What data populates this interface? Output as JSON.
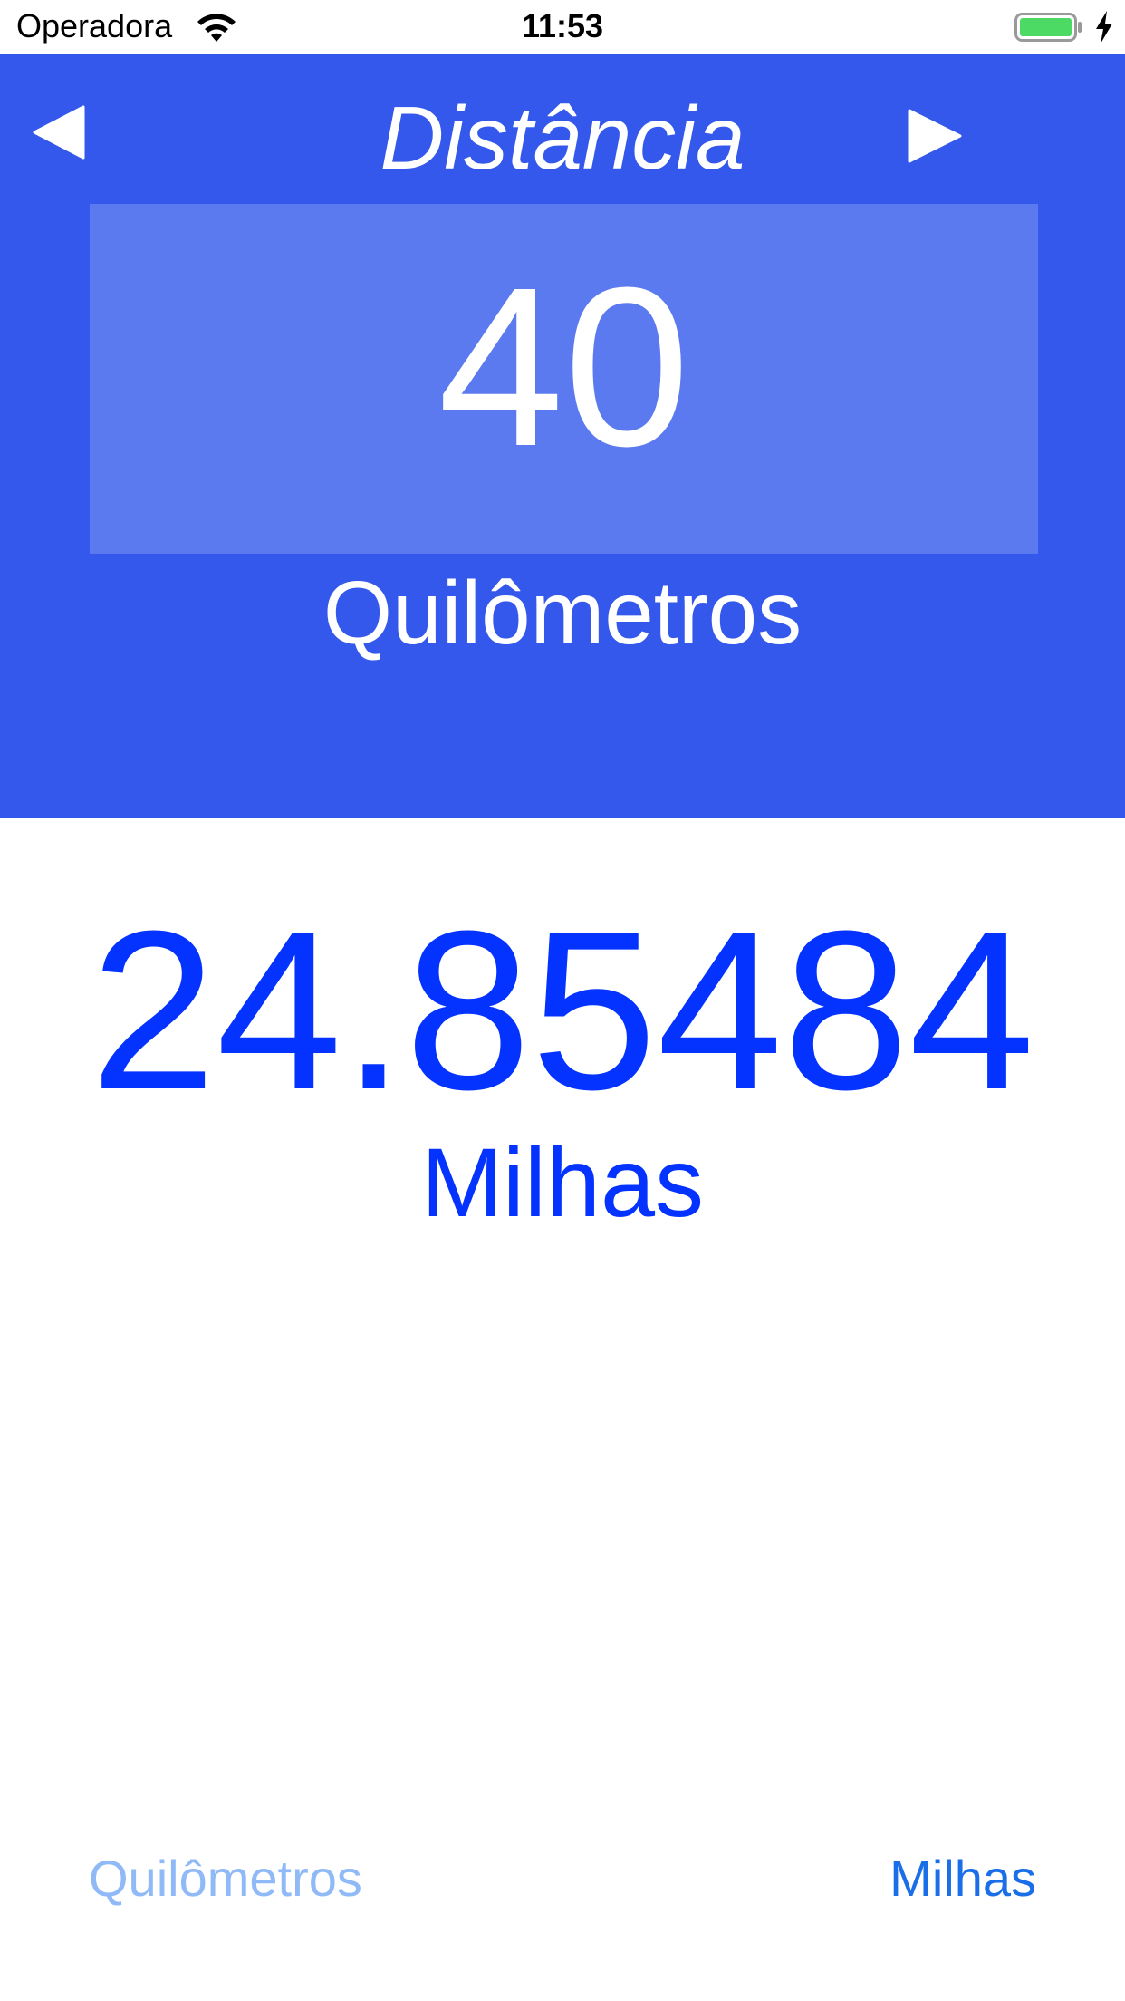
{
  "status_bar": {
    "carrier": "Operadora",
    "time": "11:53",
    "wifi_icon": "wifi-icon",
    "battery_icon": "battery-icon",
    "charging_icon": "charging-icon",
    "battery_color": "#4cd964"
  },
  "header": {
    "title": "Distância",
    "prev_icon": "triangle-left-icon",
    "next_icon": "triangle-right-icon",
    "background_color": "#3358eb",
    "input_box_color": "#5b7aef"
  },
  "input": {
    "value": "40",
    "unit": "Quilômetros"
  },
  "result": {
    "value": "24.85484",
    "unit": "Milhas",
    "color": "#0433ff"
  },
  "unit_selector": {
    "left_label": "Quilômetros",
    "right_label": "Milhas",
    "left_color": "#8fbaf7",
    "right_color": "#1a6fe8"
  }
}
